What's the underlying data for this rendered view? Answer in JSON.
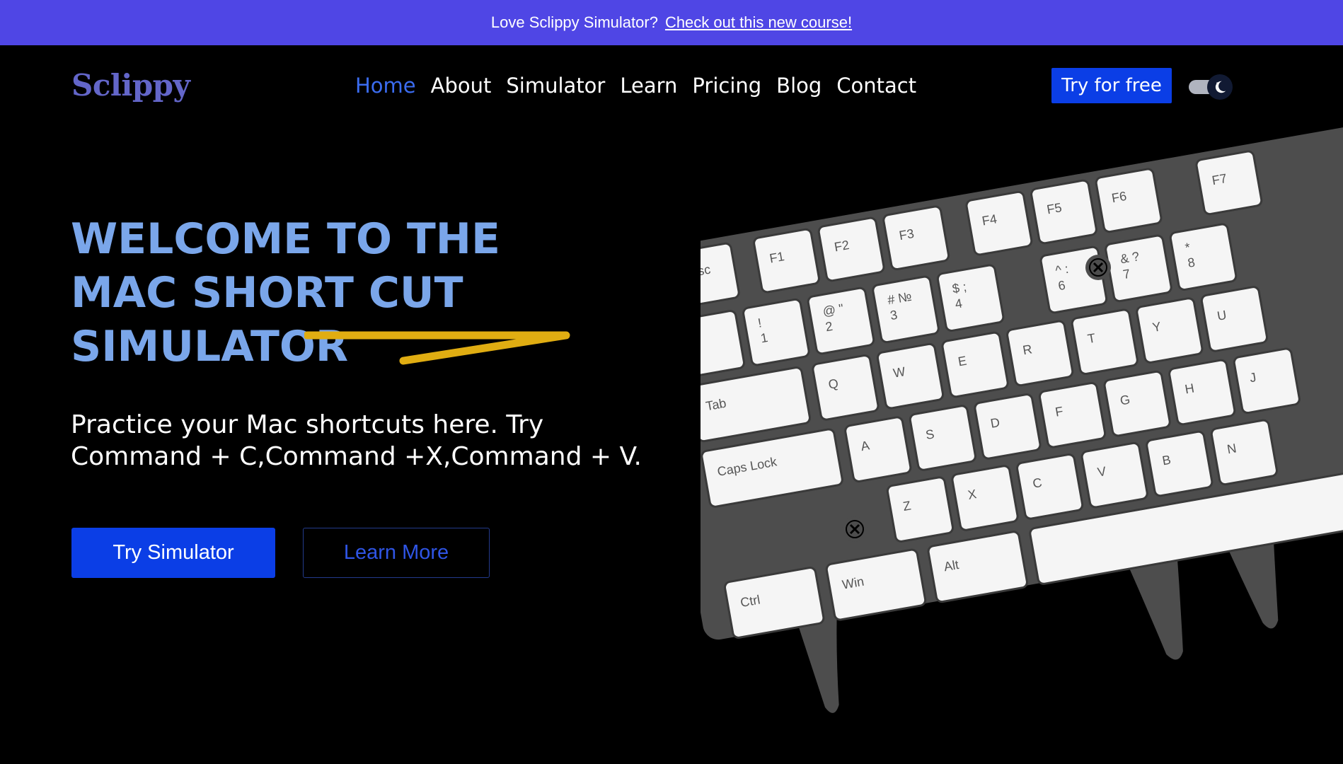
{
  "banner": {
    "text": "Love Sclippy Simulator?",
    "link": "Check out this new course!"
  },
  "header": {
    "logo": "Sclippy",
    "nav": [
      "Home",
      "About",
      "Simulator",
      "Learn",
      "Pricing",
      "Blog",
      "Contact"
    ],
    "active_nav": "Home",
    "cta": "Try for free",
    "theme_toggle_icon": "moon-icon"
  },
  "hero": {
    "title": "WELCOME TO THE MAC SHORT CUT SIMULATOR",
    "description": "Practice your Mac shortcuts here. Try Command + C,Command +X,Command + V.",
    "primary_button": "Try Simulator",
    "secondary_button": "Learn More",
    "underline_color": "#e0ad12"
  },
  "keyboard": {
    "function_row": [
      "Esc",
      "F1",
      "F2",
      "F3",
      "F4",
      "F5",
      "F6",
      "F7"
    ],
    "number_row": [
      {
        "top": "~",
        "bottom": "`"
      },
      {
        "top": "!",
        "bottom": "1"
      },
      {
        "top": "@ \"",
        "bottom": "2"
      },
      {
        "top": "# №",
        "bottom": "3"
      },
      {
        "top": "$ ;",
        "bottom": "4"
      },
      {
        "top": "^ :",
        "bottom": "6"
      },
      {
        "top": "& ?",
        "bottom": "7"
      },
      {
        "top": "*",
        "bottom": "8"
      }
    ],
    "tab": "Tab",
    "letters_row1": [
      "Q",
      "W",
      "E",
      "R",
      "T",
      "Y",
      "U"
    ],
    "caps": "Caps Lock",
    "letters_row2": [
      "A",
      "S",
      "D",
      "F",
      "G",
      "H",
      "J"
    ],
    "letters_row3": [
      "Z",
      "X",
      "C",
      "V",
      "B",
      "N"
    ],
    "bottom_row": [
      "Ctrl",
      "Win",
      "Alt"
    ],
    "missing_key_icon": "x-circle-icon"
  },
  "colors": {
    "banner": "#4f46e5",
    "logo": "#6366c9",
    "title": "#7aa6ea",
    "accent": "#0b3ee6"
  }
}
